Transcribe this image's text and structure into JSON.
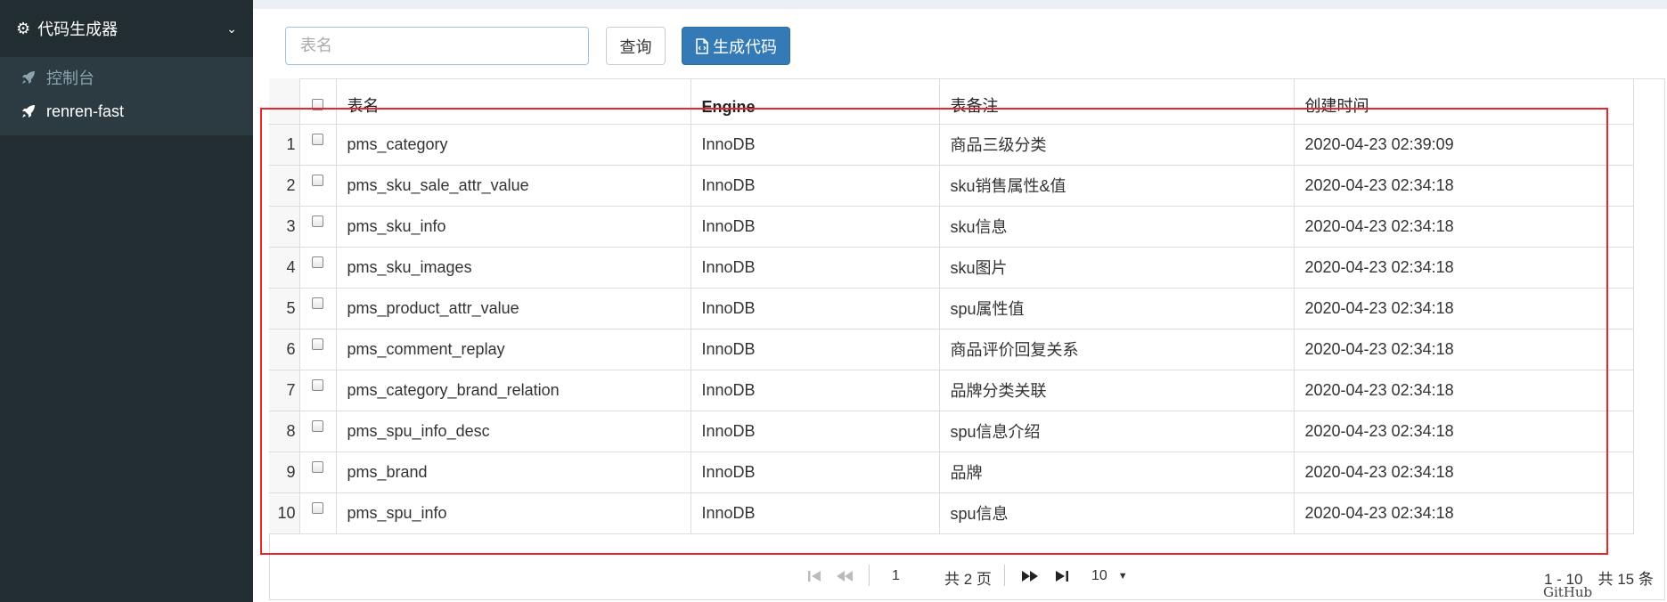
{
  "sidebar": {
    "header": "代码生成器",
    "items": [
      {
        "label": "控制台",
        "state": "muted"
      },
      {
        "label": "renren-fast",
        "state": "active"
      }
    ]
  },
  "toolbar": {
    "search_placeholder": "表名",
    "search_value": "",
    "query_label": "查询",
    "generate_label": "生成代码"
  },
  "table": {
    "columns": [
      "表名",
      "Engine",
      "表备注",
      "创建时间"
    ],
    "rows": [
      {
        "num": "1",
        "name": "pms_category",
        "engine": "InnoDB",
        "comment": "商品三级分类",
        "created": "2020-04-23 02:39:09"
      },
      {
        "num": "2",
        "name": "pms_sku_sale_attr_value",
        "engine": "InnoDB",
        "comment": "sku销售属性&值",
        "created": "2020-04-23 02:34:18"
      },
      {
        "num": "3",
        "name": "pms_sku_info",
        "engine": "InnoDB",
        "comment": "sku信息",
        "created": "2020-04-23 02:34:18"
      },
      {
        "num": "4",
        "name": "pms_sku_images",
        "engine": "InnoDB",
        "comment": "sku图片",
        "created": "2020-04-23 02:34:18"
      },
      {
        "num": "5",
        "name": "pms_product_attr_value",
        "engine": "InnoDB",
        "comment": "spu属性值",
        "created": "2020-04-23 02:34:18"
      },
      {
        "num": "6",
        "name": "pms_comment_replay",
        "engine": "InnoDB",
        "comment": "商品评价回复关系",
        "created": "2020-04-23 02:34:18"
      },
      {
        "num": "7",
        "name": "pms_category_brand_relation",
        "engine": "InnoDB",
        "comment": "品牌分类关联",
        "created": "2020-04-23 02:34:18"
      },
      {
        "num": "8",
        "name": "pms_spu_info_desc",
        "engine": "InnoDB",
        "comment": "spu信息介绍",
        "created": "2020-04-23 02:34:18"
      },
      {
        "num": "9",
        "name": "pms_brand",
        "engine": "InnoDB",
        "comment": "品牌",
        "created": "2020-04-23 02:34:18"
      },
      {
        "num": "10",
        "name": "pms_spu_info",
        "engine": "InnoDB",
        "comment": "spu信息",
        "created": "2020-04-23 02:34:18"
      }
    ]
  },
  "pager": {
    "current_page": "1",
    "total_pages": "共 2 页",
    "page_size": "10",
    "range": "1 - 10　共 15 条"
  },
  "watermark": "GitHub NiceSeason",
  "colors": {
    "sidebar_bg": "#222d32",
    "submenu_bg": "#2c3b41",
    "primary": "#337ab7",
    "highlight_box": "#e8272b"
  }
}
